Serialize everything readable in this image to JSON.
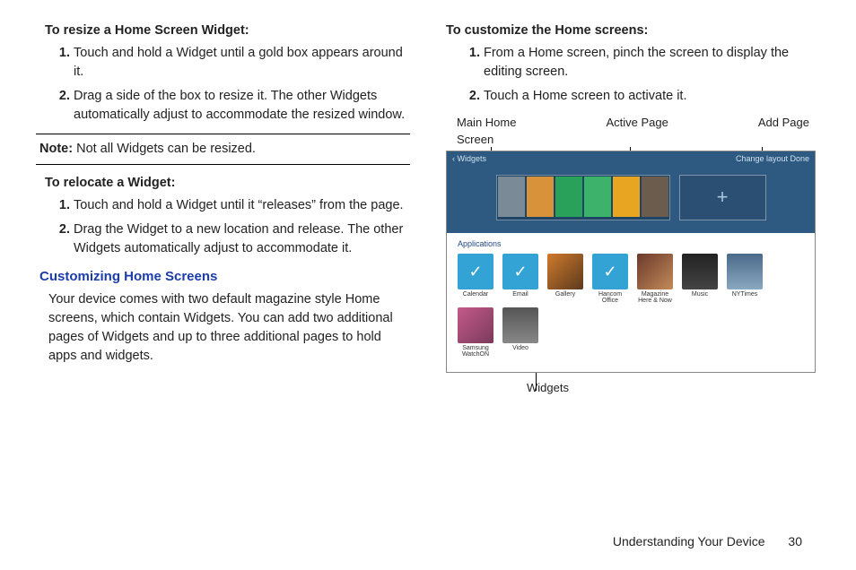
{
  "left": {
    "resizeHeading": "To resize a Home Screen Widget:",
    "resizeSteps": [
      "Touch and hold a Widget until a gold box appears around it.",
      "Drag a side of the box to resize it. The other Widgets automatically adjust to accommodate the resized window."
    ],
    "noteLabel": "Note:",
    "noteText": " Not all Widgets can be resized.",
    "relocateHeading": "To relocate a Widget:",
    "relocateSteps": [
      "Touch and hold a Widget until it “releases” from the page.",
      "Drag the Widget to a new location and release. The other Widgets automatically adjust to accommodate it."
    ],
    "sectionTitle": "Customizing Home Screens",
    "sectionBody": "Your device comes with two default magazine style Home screens, which contain Widgets. You can add two additional pages of Widgets and up to three additional pages to hold apps and widgets."
  },
  "right": {
    "customizeHeading": "To customize the Home screens:",
    "customizeSteps": [
      "From a Home screen, pinch the screen to display the editing screen.",
      "Touch a Home screen to activate it."
    ],
    "callouts": {
      "main": "Main Home\nScreen",
      "active": "Active Page",
      "add": "Add Page"
    },
    "fig": {
      "topLeft": "Widgets",
      "topRight": "Change layout    Done",
      "plus": "+",
      "appsLabel": "Applications",
      "row1": [
        "Calendar",
        "Email",
        "Gallery",
        "Hancom Office",
        "Magazine Here & Now",
        "Music",
        "NYTimes"
      ],
      "row2": [
        "Samsung WatchON",
        "Video"
      ]
    },
    "widgetsLabel": "Widgets"
  },
  "footer": {
    "section": "Understanding Your Device",
    "page": "30"
  },
  "colors": {
    "c1": "#7a8a96",
    "c2": "#d8923a",
    "c3": "#2aa15b",
    "c4": "#3cb26b",
    "c5": "#e7a521",
    "c6": "#6b5c4e",
    "tileBlue": "#33a3d6"
  }
}
